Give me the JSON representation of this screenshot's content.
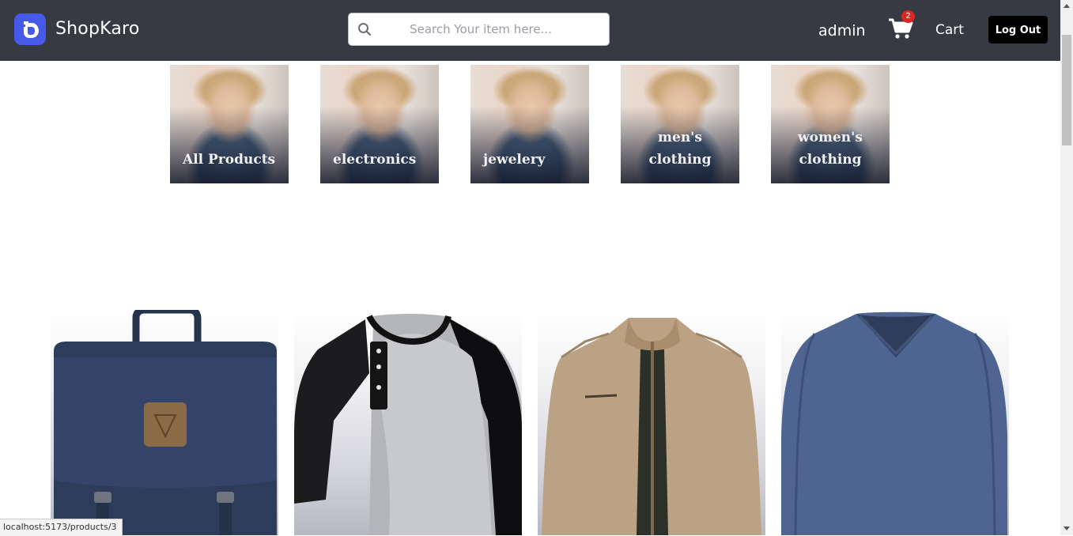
{
  "header": {
    "brand": "ShopKaro",
    "search_placeholder": "Search Your item here...",
    "user": "admin",
    "cart_count": "2",
    "cart_label": "Cart",
    "logout_label": "Log Out"
  },
  "categories": [
    {
      "label": "All Products"
    },
    {
      "label": "electronics"
    },
    {
      "label": "jewelery"
    },
    {
      "label": "men's clothing"
    },
    {
      "label": "women's clothing"
    }
  ],
  "products": [
    {
      "icon": "backpack-image"
    },
    {
      "icon": "raglan-henley-shirt-image"
    },
    {
      "icon": "khaki-jacket-image"
    },
    {
      "icon": "blue-vneck-shirt-image"
    }
  ],
  "status_url": "localhost:5173/products/3",
  "colors": {
    "header_bg": "#373a43",
    "logo_bg": "#4759e8",
    "badge": "#e02424",
    "logout_bg": "#000000"
  }
}
